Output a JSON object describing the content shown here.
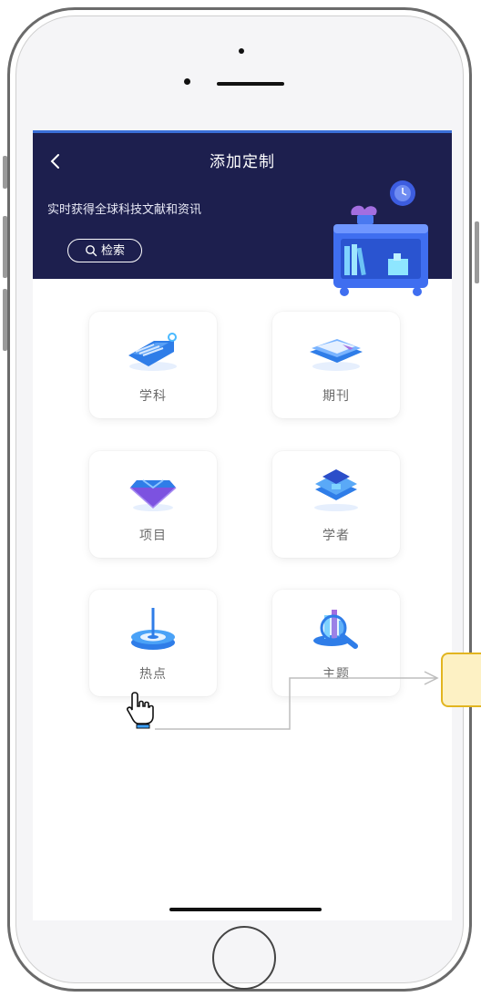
{
  "header": {
    "back_icon": "chevron-left-icon",
    "title": "添加定制",
    "subtitle": "实时获得全球科技文献和资讯",
    "search_label": "检索",
    "accent": "#1d1f4e"
  },
  "cards": [
    {
      "label": "学科",
      "icon": "tag-icon"
    },
    {
      "label": "期刊",
      "icon": "book-icon"
    },
    {
      "label": "项目",
      "icon": "diamond-icon"
    },
    {
      "label": "学者",
      "icon": "graduation-cap-icon"
    },
    {
      "label": "热点",
      "icon": "target-icon"
    },
    {
      "label": "主题",
      "icon": "magnifier-chart-icon"
    }
  ],
  "colors": {
    "card_icon_blue": "#2f7de8",
    "callout_fill": "#fdf1c4",
    "callout_border": "#e2b520"
  }
}
